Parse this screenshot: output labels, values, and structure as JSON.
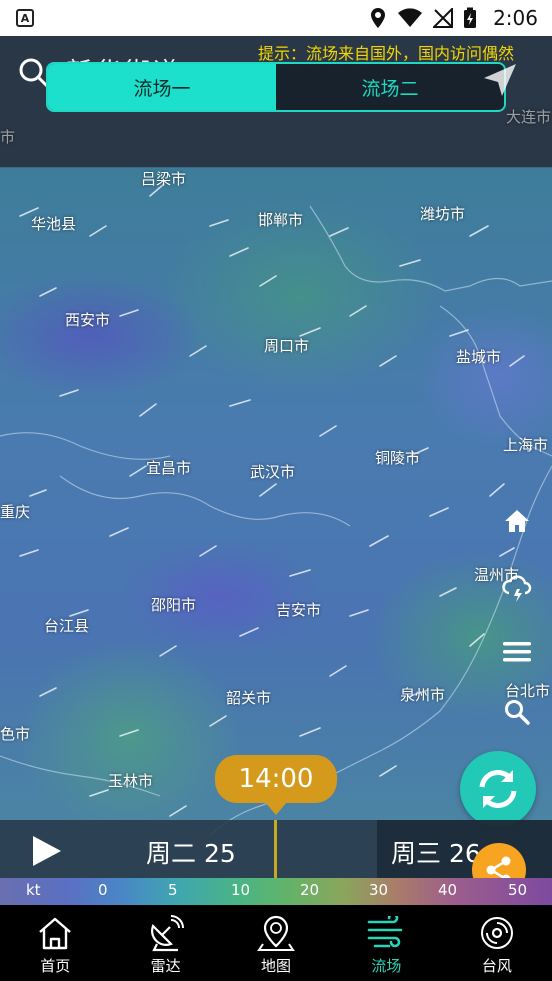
{
  "status_bar": {
    "time": "2:06",
    "app_badge": "A"
  },
  "header": {
    "ghost_title": "新华街道",
    "hint": "提示：流场来自国外，国内访问偶然",
    "segments": [
      {
        "label": "流场一",
        "active": true
      },
      {
        "label": "流场二",
        "active": false
      }
    ]
  },
  "map": {
    "cities": {
      "lvliang": "吕梁市",
      "huachi": "华池县",
      "handan": "邯郸市",
      "weifang": "潍坊市",
      "xian": "西安市",
      "zhoukou": "周口市",
      "yancheng": "盐城市",
      "shanghai": "上海市",
      "yichang": "宜昌市",
      "wuhan": "武汉市",
      "tongling": "铜陵市",
      "chongqing": "重庆",
      "wenzhou": "温州市",
      "shaoyang": "邵阳市",
      "jian": "吉安市",
      "taijiang": "台江县",
      "shaoguan": "韶关市",
      "quanzhou": "泉州市",
      "taibei": "台北市",
      "baise": "色市",
      "yulin": "玉林市",
      "dalian": "大连市",
      "top_left": "市"
    }
  },
  "time_tooltip": "14:00",
  "timeline": {
    "day_left": "周二 25",
    "day_right": "周三 26"
  },
  "legend": {
    "unit": "kt",
    "ticks": [
      "0",
      "5",
      "10",
      "20",
      "30",
      "40",
      "50"
    ]
  },
  "bottom_nav": [
    {
      "label": "首页",
      "icon": "home-icon",
      "active": false
    },
    {
      "label": "雷达",
      "icon": "radar-icon",
      "active": false
    },
    {
      "label": "地图",
      "icon": "map-pin-icon",
      "active": false
    },
    {
      "label": "流场",
      "icon": "wind-icon",
      "active": true
    },
    {
      "label": "台风",
      "icon": "typhoon-icon",
      "active": false
    }
  ],
  "colors": {
    "accent": "#1de0cc",
    "hint": "#f2d800",
    "time_bubble": "#d59a1c",
    "share": "#f7a420"
  }
}
